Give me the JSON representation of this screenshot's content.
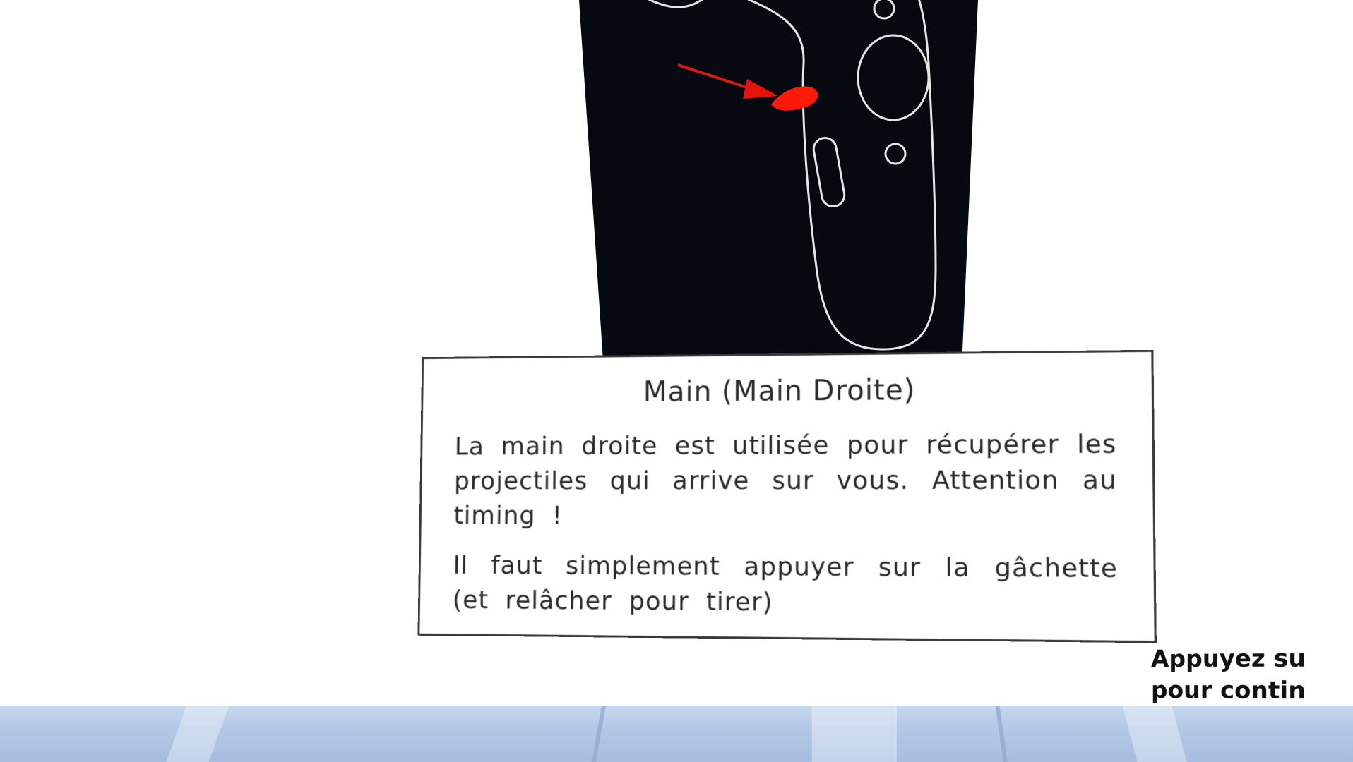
{
  "tutorial_card": {
    "title": "Main (Main Droite)",
    "paragraph_1": "La main droite est utilisée pour récupérer les projectiles qui arrive sur vous. Attention au timing !",
    "paragraph_2": "Il faut simplement appuyer sur la gâchette (et relâcher pour tirer)"
  },
  "continue_hint": {
    "line_1": "Appuyez su",
    "line_2": "pour contin"
  },
  "controller_image": {
    "icon": "vr-controller-icon",
    "highlight_icon": "trigger-highlight-icon",
    "arrow_icon": "arrow-icon",
    "highlight_color": "#ff1a0a",
    "background_color": "#06090f",
    "outline_color": "#e6e6e6"
  },
  "floor": {
    "color": "#b4c8e6"
  }
}
